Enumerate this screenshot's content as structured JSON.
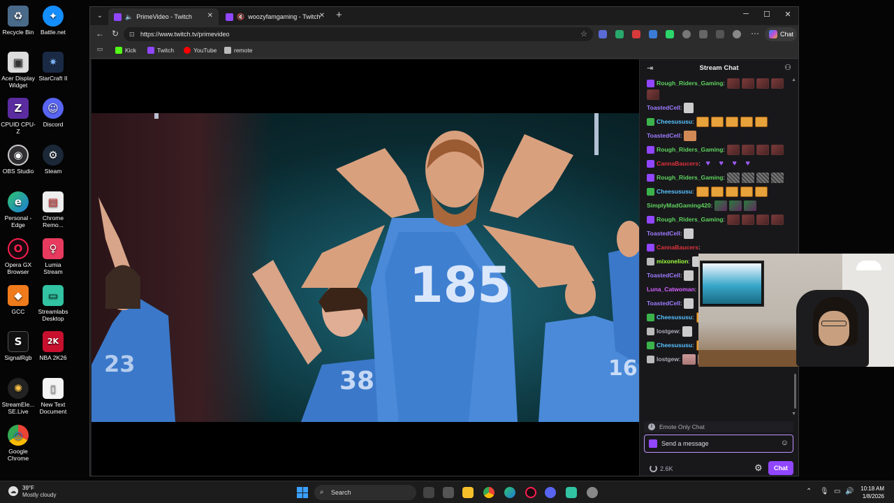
{
  "desktop": {
    "icons": [
      {
        "label": "Recycle Bin",
        "glyph": "♻"
      },
      {
        "label": "Battle.net",
        "glyph": "✦"
      },
      {
        "label": "Acer Display Widget",
        "glyph": "▣"
      },
      {
        "label": "StarCraft II",
        "glyph": "✷"
      },
      {
        "label": "CPUID CPU-Z",
        "glyph": "Z"
      },
      {
        "label": "Discord",
        "glyph": "☺"
      },
      {
        "label": "OBS Studio",
        "glyph": "◉"
      },
      {
        "label": "Steam",
        "glyph": "⚙"
      },
      {
        "label": "Personal - Edge",
        "glyph": "e"
      },
      {
        "label": "Chrome Remo...",
        "glyph": "▤"
      },
      {
        "label": "Opera GX Browser",
        "glyph": "O"
      },
      {
        "label": "Lumia Stream",
        "glyph": "♀"
      },
      {
        "label": "GCC",
        "glyph": "◆"
      },
      {
        "label": "Streamlabs Desktop",
        "glyph": "▭"
      },
      {
        "label": "SignalRgb",
        "glyph": "S"
      },
      {
        "label": "NBA 2K26",
        "glyph": "2K"
      },
      {
        "label": "StreamEle... SE.Live",
        "glyph": "✺"
      },
      {
        "label": "New Text Document",
        "glyph": "▯"
      },
      {
        "label": "Google Chrome",
        "glyph": "◎"
      }
    ]
  },
  "browser": {
    "tabs": [
      {
        "title": "PrimeVideo - Twitch",
        "speaker": "🔈"
      },
      {
        "title": "woozyfamgaming - Twitch",
        "speaker": "🔇"
      }
    ],
    "new_tab": "+",
    "window_controls": {
      "minimize": "─",
      "maximize": "☐",
      "close": "✕"
    },
    "url": "https://www.twitch.tv/primevideo",
    "copilot_label": "Chat",
    "favorites": [
      {
        "label": "Kick",
        "color": "#53fc18"
      },
      {
        "label": "Twitch",
        "color": "#9146ff"
      },
      {
        "label": "YouTube",
        "color": "#ff0000"
      },
      {
        "label": "remote",
        "color": "#bbbbbb"
      }
    ]
  },
  "chat": {
    "title": "Stream Chat",
    "messages": [
      {
        "user": "Rough_Riders_Gaming",
        "color": "#5fd35f",
        "badge": "#9146ff",
        "emotes": [
          "red",
          "red",
          "red",
          "red",
          "red"
        ],
        "text": ""
      },
      {
        "user": "ToastedCell",
        "color": "#9f7cff",
        "badge": "",
        "emotes": [
          "small"
        ],
        "text": ""
      },
      {
        "user": "Cheesususu",
        "color": "#58c1ff",
        "badge": "#3bb24b",
        "emotes": [
          "gold",
          "gold",
          "gold",
          "gold",
          "gold"
        ],
        "text": ""
      },
      {
        "user": "ToastedCell",
        "color": "#9f7cff",
        "badge": "",
        "emotes": [
          "face"
        ],
        "text": ""
      },
      {
        "user": "Rough_Riders_Gaming",
        "color": "#5fd35f",
        "badge": "#9146ff",
        "emotes": [
          "red",
          "red",
          "red",
          "red"
        ],
        "text": ""
      },
      {
        "user": "CannaBaucers",
        "color": "#e0313b",
        "badge": "#9146ff",
        "emotes": [
          "heart",
          "heart",
          "heart",
          "heart"
        ],
        "text": ""
      },
      {
        "user": "Rough_Riders_Gaming",
        "color": "#5fd35f",
        "badge": "#9146ff",
        "emotes": [
          "gray",
          "gray",
          "gray",
          "gray"
        ],
        "text": ""
      },
      {
        "user": "Cheesususu",
        "color": "#58c1ff",
        "badge": "#3bb24b",
        "emotes": [
          "gold",
          "gold",
          "gold",
          "gold",
          "gold"
        ],
        "text": ""
      },
      {
        "user": "SimplyMadGaming420",
        "color": "#5fd35f",
        "badge": "",
        "emotes": [
          "dark",
          "dark",
          "dark"
        ],
        "text": ""
      },
      {
        "user": "Rough_Riders_Gaming",
        "color": "#5fd35f",
        "badge": "#9146ff",
        "emotes": [
          "red",
          "red",
          "red",
          "red"
        ],
        "text": ""
      },
      {
        "user": "ToastedCell",
        "color": "#9f7cff",
        "badge": "",
        "emotes": [
          "small"
        ],
        "text": ""
      },
      {
        "user": "CannaBaucers",
        "color": "#e0313b",
        "badge": "#9146ff",
        "emotes": [],
        "text": ""
      },
      {
        "user": "mixonelion",
        "color": "#9fff3f",
        "badge": "#bbbbbb",
        "emotes": [
          "small"
        ],
        "text": ""
      },
      {
        "user": "ToastedCell",
        "color": "#9f7cff",
        "badge": "",
        "emotes": [
          "small"
        ],
        "text": ""
      },
      {
        "user": "Luna_Catwoman",
        "color": "#d561ff",
        "badge": "",
        "emotes": [],
        "text": ""
      },
      {
        "user": "ToastedCell",
        "color": "#9f7cff",
        "badge": "",
        "emotes": [
          "small"
        ],
        "text": ""
      },
      {
        "user": "Cheesususu",
        "color": "#58c1ff",
        "badge": "#3bb24b",
        "emotes": [
          "gold",
          "gold"
        ],
        "text": ""
      },
      {
        "user": "lostgew",
        "color": "#adadb8",
        "badge": "#bbbbbb",
        "emotes": [
          "small"
        ],
        "text": ""
      },
      {
        "user": "Cheesususu",
        "color": "#58c1ff",
        "badge": "#3bb24b",
        "emotes": [
          "gold",
          "gold",
          "gold",
          "gold",
          "gold"
        ],
        "text": ""
      },
      {
        "user": "lostgew",
        "color": "#adadb8",
        "badge": "#bbbbbb",
        "emotes": [
          "pink",
          "pink",
          "pink",
          "pink"
        ],
        "text": ""
      }
    ],
    "emote_only_notice": "Emote Only Chat",
    "input_placeholder": "Send a message",
    "points": "2.6K",
    "send_button": "Chat"
  },
  "taskbar": {
    "weather_temp": "39°F",
    "weather_condition": "Mostly cloudy",
    "search_placeholder": "Search",
    "time": "10:18 AM",
    "date": "1/8/2026"
  }
}
